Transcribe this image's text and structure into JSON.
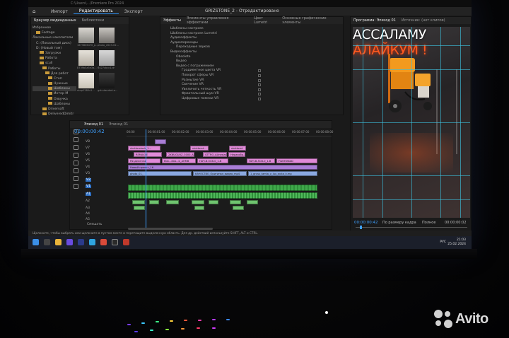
{
  "top_strip": "C:\\Users\\...\\Premiere Pro 2024",
  "menu": {
    "tabs": [
      "Импорт",
      "Редактировать",
      "Экспорт"
    ],
    "active_index": 1,
    "project_title": "GRIZSTONE_2  - Отредактировано"
  },
  "project_panel": {
    "tabs": [
      "Браузер медиаданных",
      "Библиотеки"
    ],
    "filter_label": "Избранное",
    "tree": [
      "Избранное",
      "Footage",
      "Локальные накопители",
      "C: (Локальный диск)",
      "D: (Новый том)",
      "Загрузки",
      "Работа",
      "scull",
      "Работы",
      "Для работ",
      "Стоп",
      "Нужные",
      "Шаблоны",
      "Интер М",
      "Озвучка",
      "Шаблоны",
      "Driversoft",
      "DeliveredDimitr"
    ],
    "thumb_labels": [
      "1673806470_p...",
      "photo_2023-02...",
      "8739b5a5e3a...",
      "6427cbcc4.dr",
      "skup1280x1...",
      "gdr-standart-a...",
      "42-1898334...",
      "utomastdchbr"
    ]
  },
  "effects_panel": {
    "tabs": [
      "Эффекты",
      "Элементы управления эффектами",
      "Цвет Lumetri",
      "Основные графические элементы"
    ],
    "items": [
      "Шаблоны настроек",
      "Шаблоны настроек Lumetri",
      "Аудиоэффекты",
      "Аудиопереходы",
      "Переходные звуков",
      "Видеоэффекты",
      "Obsolete",
      "Видео",
      "Видео с погружением",
      "Градиентное цвета VR",
      "Поворот сферы VR",
      "Размытие VR",
      "Свечение VR",
      "Увеличить четкость VR",
      "Фрактальный шум VR",
      "Цифровые помехи VR"
    ]
  },
  "timeline": {
    "tabs": [
      "Эпизод 01",
      "Эпизод 01"
    ],
    "timecode": "00:00:00:42",
    "ruler": [
      "00:00",
      "00:00:01:00",
      "00:00:02:00",
      "00:00:03:00",
      "00:00:04:00",
      "00:00:05:00",
      "00:00:06:00",
      "00:00:07:00",
      "00:00:08:00"
    ],
    "video_tracks": [
      "V8",
      "V7",
      "V6",
      "V5",
      "V4",
      "V3",
      "V2",
      "V1"
    ],
    "audio_tracks": [
      "A1",
      "A2",
      "A3",
      "A4",
      "A5"
    ],
    "mix_label": "Смешать",
    "clips_top": [
      "shutterstock_1...",
      "shutterst...",
      "shutterst"
    ],
    "clips_mid": [
      "REMAXIIE",
      "2XNUGUUZ_3000_A_DUEZ",
      "GTTRO_AUnesiaa",
      "Неразобр...",
      "НАЧ-В-5СВ-0_1-В",
      "FlatHWNAD"
    ],
    "clips_low": [
      "Разделенна",
      "Ebb...dbb...b_AHMB",
      "Неразобранный",
      "НАЧ-В-5СВ-0_1-В",
      "Новый проект_16"
    ],
    "clips_base": [
      "photo_01_",
      "КАЧЕСТВО_Оригинал_видео_mp4",
      "1_gruss_tamla_v_luu_wuta_k.mp"
    ]
  },
  "program_monitor": {
    "tabs": [
      "Программа: Эпизод 01",
      "Источник: (нет клипов)"
    ],
    "headline_line1": "АССАЛАМУ",
    "headline_line2": "АЛАЙКУМ !",
    "timecode_left": "00:00:00:42",
    "fit_label": "По размеру кадра",
    "quality_label": "Полное",
    "timecode_right": "00:00:00:02",
    "accent_color": "#ff5a1f"
  },
  "status_bar": "Щелкните, чтобы выбрать или щелкните в пустом месте и перетащите выделенную область. Для др. действий используйте SHIFT, ALT и CTRL.",
  "taskbar": {
    "lang": "РУС",
    "time": "21:03",
    "date": "25.02.2024"
  },
  "watermark": "Avito"
}
